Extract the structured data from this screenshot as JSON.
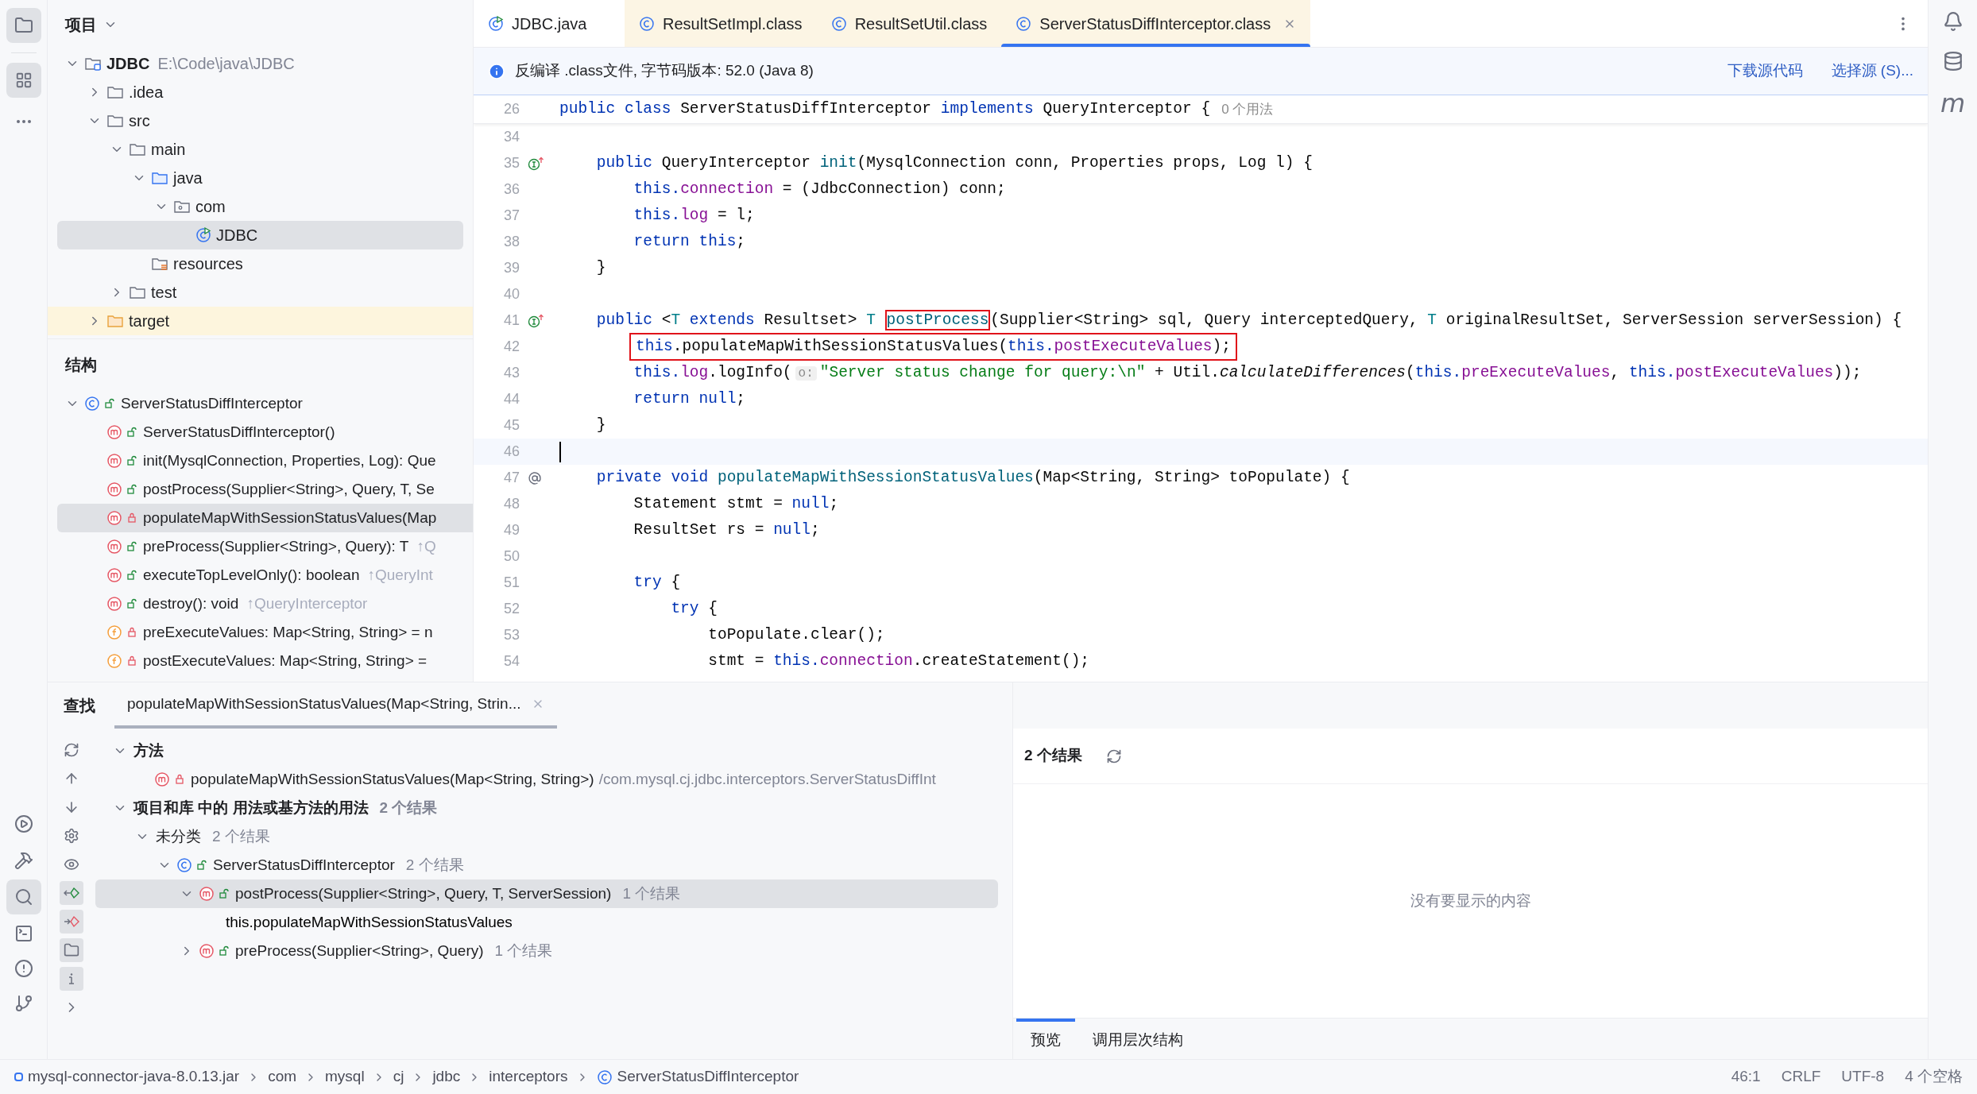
{
  "project": {
    "title": "项目",
    "tree": [
      {
        "label": "JDBC",
        "path": "E:\\Code\\java\\JDBC",
        "kind": "module",
        "expanded": true,
        "selected": false,
        "children": [
          {
            "label": ".idea",
            "kind": "folder",
            "expanded": false,
            "selected": false
          },
          {
            "label": "src",
            "kind": "folder",
            "expanded": true,
            "selected": false,
            "children": [
              {
                "label": "main",
                "kind": "folder",
                "expanded": true,
                "selected": false,
                "children": [
                  {
                    "label": "java",
                    "kind": "source-folder",
                    "expanded": true,
                    "selected": false,
                    "children": [
                      {
                        "label": "com",
                        "kind": "package",
                        "expanded": true,
                        "selected": false,
                        "children": [
                          {
                            "label": "JDBC",
                            "kind": "runnable-class",
                            "selected": true
                          }
                        ]
                      }
                    ]
                  },
                  {
                    "label": "resources",
                    "kind": "resources-folder",
                    "selected": false
                  }
                ]
              },
              {
                "label": "test",
                "kind": "folder",
                "expanded": false,
                "selected": false
              }
            ]
          },
          {
            "label": "target",
            "kind": "excluded-folder",
            "expanded": false,
            "selected": false
          }
        ]
      }
    ]
  },
  "structure": {
    "title": "结构",
    "tree": [
      {
        "label": "ServerStatusDiffInterceptor",
        "kind": "class",
        "private": false,
        "expanded": true,
        "selected": false,
        "children": [
          {
            "label": "ServerStatusDiffInterceptor()",
            "kind": "method",
            "private": false,
            "selected": false
          },
          {
            "label": "init(MysqlConnection, Properties, Log): Que",
            "kind": "method",
            "private": false,
            "selected": false
          },
          {
            "label": "postProcess(Supplier<String>, Query, T, Se",
            "kind": "method",
            "private": false,
            "selected": false
          },
          {
            "label": "populateMapWithSessionStatusValues(Map",
            "kind": "method",
            "private": true,
            "selected": true
          },
          {
            "label": "preProcess(Supplier<String>, Query): T",
            "hint": "↑Q",
            "kind": "method",
            "private": false,
            "selected": false
          },
          {
            "label": "executeTopLevelOnly(): boolean",
            "hint": "↑QueryInt",
            "kind": "method",
            "private": false,
            "selected": false
          },
          {
            "label": "destroy(): void",
            "hint": "↑QueryInterceptor",
            "kind": "method",
            "private": false,
            "selected": false
          },
          {
            "label": "preExecuteValues: Map<String, String> = n",
            "kind": "field",
            "private": true,
            "selected": false
          },
          {
            "label": "postExecuteValues: Map<String, String> =",
            "kind": "field",
            "private": true,
            "selected": false
          }
        ]
      }
    ]
  },
  "editor": {
    "tabs": [
      {
        "label": "JDBC.java",
        "kind": "source",
        "selected": false
      },
      {
        "label": "ResultSetImpl.class",
        "kind": "compiled",
        "selected": false
      },
      {
        "label": "ResultSetUtil.class",
        "kind": "compiled",
        "selected": false
      },
      {
        "label": "ServerStatusDiffInterceptor.class",
        "kind": "compiled",
        "selected": true
      }
    ],
    "banner": {
      "message": "反编译 .class文件, 字节码版本: 52.0 (Java 8)",
      "links": [
        "下载源代码",
        "选择源 (S)..."
      ]
    },
    "sticky_line": {
      "number": "26",
      "tokens": [
        {
          "kind": "kw",
          "text": "public class "
        },
        {
          "kind": "plain",
          "text": "ServerStatusDiffInterceptor "
        },
        {
          "kind": "kw",
          "text": "implements "
        },
        {
          "kind": "plain",
          "text": "QueryInterceptor {"
        }
      ],
      "usages": "0 个用法"
    },
    "lines": [
      {
        "number": "34",
        "kind": "code",
        "current": false,
        "boxed": false
      },
      {
        "number": "35",
        "kind": "implements-marker",
        "current": false,
        "boxed": false,
        "tokens": [
          {
            "kind": "kw",
            "text": "    public "
          },
          {
            "kind": "plain",
            "text": "QueryInterceptor "
          },
          {
            "kind": "decl",
            "text": "init"
          },
          {
            "kind": "plain",
            "text": "(MysqlConnection conn, Properties props, Log l) {"
          }
        ]
      },
      {
        "number": "36",
        "kind": "code",
        "current": false,
        "boxed": false,
        "tokens": [
          {
            "kind": "kw",
            "text": "        this."
          },
          {
            "kind": "field",
            "text": "connection"
          },
          {
            "kind": "plain",
            "text": " = (JdbcConnection) conn;"
          }
        ]
      },
      {
        "number": "37",
        "kind": "code",
        "current": false,
        "boxed": false,
        "tokens": [
          {
            "kind": "kw",
            "text": "        this."
          },
          {
            "kind": "field",
            "text": "log"
          },
          {
            "kind": "plain",
            "text": " = l;"
          }
        ]
      },
      {
        "number": "38",
        "kind": "code",
        "current": false,
        "boxed": false,
        "tokens": [
          {
            "kind": "kw",
            "text": "        return this"
          },
          {
            "kind": "plain",
            "text": ";"
          }
        ]
      },
      {
        "number": "39",
        "kind": "code",
        "current": false,
        "boxed": false,
        "tokens": [
          {
            "kind": "plain",
            "text": "    }"
          }
        ]
      },
      {
        "number": "40",
        "kind": "code",
        "current": false,
        "boxed": false
      },
      {
        "number": "41",
        "kind": "implements-marker",
        "current": false,
        "boxed": false,
        "tokens": [
          {
            "kind": "kw",
            "text": "    public "
          },
          {
            "kind": "plain",
            "text": "<"
          },
          {
            "kind": "tparam",
            "text": "T"
          },
          {
            "kind": "kw",
            "text": " extends "
          },
          {
            "kind": "plain",
            "text": "Resultset> "
          },
          {
            "kind": "tparam",
            "text": "T "
          },
          {
            "kind": "decl",
            "text": "postProcess",
            "boxed": true
          },
          {
            "kind": "plain",
            "text": "(Supplier<String> sql, Query interceptedQuery, "
          },
          {
            "kind": "tparam",
            "text": "T"
          },
          {
            "kind": "plain",
            "text": " originalResultSet, ServerSession serverSession) {"
          }
        ]
      },
      {
        "number": "42",
        "kind": "code",
        "current": false,
        "boxed": true,
        "tokens": [
          {
            "kind": "kw",
            "text": "this"
          },
          {
            "kind": "plain",
            "text": ".populateMapWithSessionStatusValues("
          },
          {
            "kind": "kw",
            "text": "this."
          },
          {
            "kind": "field",
            "text": "postExecuteValues"
          },
          {
            "kind": "plain",
            "text": ");"
          }
        ]
      },
      {
        "number": "43",
        "kind": "code",
        "current": false,
        "boxed": false,
        "tokens": [
          {
            "kind": "kw",
            "text": "        this."
          },
          {
            "kind": "field",
            "text": "log"
          },
          {
            "kind": "plain",
            "text": ".logInfo("
          },
          {
            "kind": "hint",
            "text": "o:"
          },
          {
            "kind": "str",
            "text": "\"Server status change for query:\\n\""
          },
          {
            "kind": "plain",
            "text": " + Util."
          },
          {
            "kind": "static",
            "text": "calculateDifferences"
          },
          {
            "kind": "plain",
            "text": "("
          },
          {
            "kind": "kw",
            "text": "this."
          },
          {
            "kind": "field",
            "text": "preExecuteValues"
          },
          {
            "kind": "plain",
            "text": ", "
          },
          {
            "kind": "kw",
            "text": "this."
          },
          {
            "kind": "field",
            "text": "postExecuteValues"
          },
          {
            "kind": "plain",
            "text": "));"
          }
        ]
      },
      {
        "number": "44",
        "kind": "code",
        "current": false,
        "boxed": false,
        "tokens": [
          {
            "kind": "kw",
            "text": "        return null"
          },
          {
            "kind": "plain",
            "text": ";"
          }
        ]
      },
      {
        "number": "45",
        "kind": "code",
        "current": false,
        "boxed": false,
        "tokens": [
          {
            "kind": "plain",
            "text": "    }"
          }
        ]
      },
      {
        "number": "46",
        "kind": "code",
        "current": true,
        "boxed": false
      },
      {
        "number": "47",
        "kind": "annotation-marker",
        "current": false,
        "boxed": false,
        "tokens": [
          {
            "kind": "kw",
            "text": "    private void "
          },
          {
            "kind": "decl",
            "text": "populateMapWithSessionStatusValues"
          },
          {
            "kind": "plain",
            "text": "(Map<String, String> toPopulate) {"
          }
        ]
      },
      {
        "number": "48",
        "kind": "code",
        "current": false,
        "boxed": false,
        "tokens": [
          {
            "kind": "plain",
            "text": "        Statement stmt = "
          },
          {
            "kind": "kw",
            "text": "null"
          },
          {
            "kind": "plain",
            "text": ";"
          }
        ]
      },
      {
        "number": "49",
        "kind": "code",
        "current": false,
        "boxed": false,
        "tokens": [
          {
            "kind": "plain",
            "text": "        ResultSet rs = "
          },
          {
            "kind": "kw",
            "text": "null"
          },
          {
            "kind": "plain",
            "text": ";"
          }
        ]
      },
      {
        "number": "50",
        "kind": "code",
        "current": false,
        "boxed": false
      },
      {
        "number": "51",
        "kind": "code",
        "current": false,
        "boxed": false,
        "tokens": [
          {
            "kind": "kw",
            "text": "        try "
          },
          {
            "kind": "plain",
            "text": "{"
          }
        ]
      },
      {
        "number": "52",
        "kind": "code",
        "current": false,
        "boxed": false,
        "tokens": [
          {
            "kind": "kw",
            "text": "            try "
          },
          {
            "kind": "plain",
            "text": "{"
          }
        ]
      },
      {
        "number": "53",
        "kind": "code",
        "current": false,
        "boxed": false,
        "tokens": [
          {
            "kind": "plain",
            "text": "                toPopulate.clear();"
          }
        ]
      },
      {
        "number": "54",
        "kind": "code",
        "current": false,
        "boxed": false,
        "tokens": [
          {
            "kind": "plain",
            "text": "                stmt = "
          },
          {
            "kind": "kw",
            "text": "this."
          },
          {
            "kind": "field",
            "text": "connection"
          },
          {
            "kind": "plain",
            "text": ".createStatement();"
          }
        ]
      }
    ]
  },
  "find": {
    "title": "查找",
    "tab": {
      "label": "populateMapWithSessionStatusValues(Map<String, Strin...",
      "selected": true
    },
    "toolbar": [
      {
        "kind": "rerun",
        "on": false
      },
      {
        "kind": "previous",
        "on": false
      },
      {
        "kind": "next",
        "on": false
      },
      {
        "kind": "settings",
        "on": false
      },
      {
        "kind": "preview",
        "on": false
      },
      {
        "kind": "read-access",
        "on": true
      },
      {
        "kind": "write-access",
        "on": true
      },
      {
        "kind": "group-by-directory",
        "on": true
      },
      {
        "kind": "info",
        "on": true
      },
      {
        "kind": "more",
        "on": false
      }
    ],
    "tree": [
      {
        "kind": "group",
        "label": "方法",
        "expanded": true,
        "selected": false,
        "children": [
          {
            "kind": "method",
            "private": true,
            "label": "populateMapWithSessionStatusValues(Map<String, String>)",
            "location": "/com.mysql.cj.jdbc.interceptors.ServerStatusDiffInt",
            "selected": false
          }
        ]
      },
      {
        "kind": "group",
        "label": "项目和库 中的 用法或基方法的用法",
        "count": "2 个结果",
        "expanded": true,
        "selected": false,
        "children": [
          {
            "kind": "category",
            "label": "未分类",
            "count": "2 个结果",
            "expanded": true,
            "selected": false,
            "children": [
              {
                "kind": "class",
                "private": false,
                "label": "ServerStatusDiffInterceptor",
                "count": "2 个结果",
                "expanded": true,
                "selected": false,
                "children": [
                  {
                    "kind": "method",
                    "private": false,
                    "label": "postProcess(Supplier<String>, Query, T, ServerSession)",
                    "count": "1 个结果",
                    "expanded": true,
                    "selected": true,
                    "children": [
                      {
                        "kind": "usage",
                        "label": "this.populateMapWithSessionStatusValues",
                        "selected": false
                      }
                    ]
                  },
                  {
                    "kind": "method",
                    "private": false,
                    "label": "preProcess(Supplier<String>, Query)",
                    "count": "1 个结果",
                    "expanded": false,
                    "selected": false
                  }
                ]
              }
            ]
          }
        ]
      }
    ],
    "preview": {
      "header": "2 个结果",
      "empty_text": "没有要显示的内容",
      "tabs": [
        {
          "label": "预览",
          "selected": true
        },
        {
          "label": "调用层次结构",
          "selected": false
        }
      ]
    }
  },
  "right_strip": {
    "maven_label": "m"
  },
  "status_bar": {
    "breadcrumbs": [
      {
        "label": "mysql-connector-java-8.0.13.jar",
        "kind": "jar"
      },
      {
        "label": "com",
        "kind": "package"
      },
      {
        "label": "mysql",
        "kind": "package"
      },
      {
        "label": "cj",
        "kind": "package"
      },
      {
        "label": "jdbc",
        "kind": "package"
      },
      {
        "label": "interceptors",
        "kind": "package"
      },
      {
        "label": "ServerStatusDiffInterceptor",
        "kind": "class"
      }
    ],
    "items": [
      "46:1",
      "CRLF",
      "UTF-8",
      "4 个空格"
    ]
  }
}
